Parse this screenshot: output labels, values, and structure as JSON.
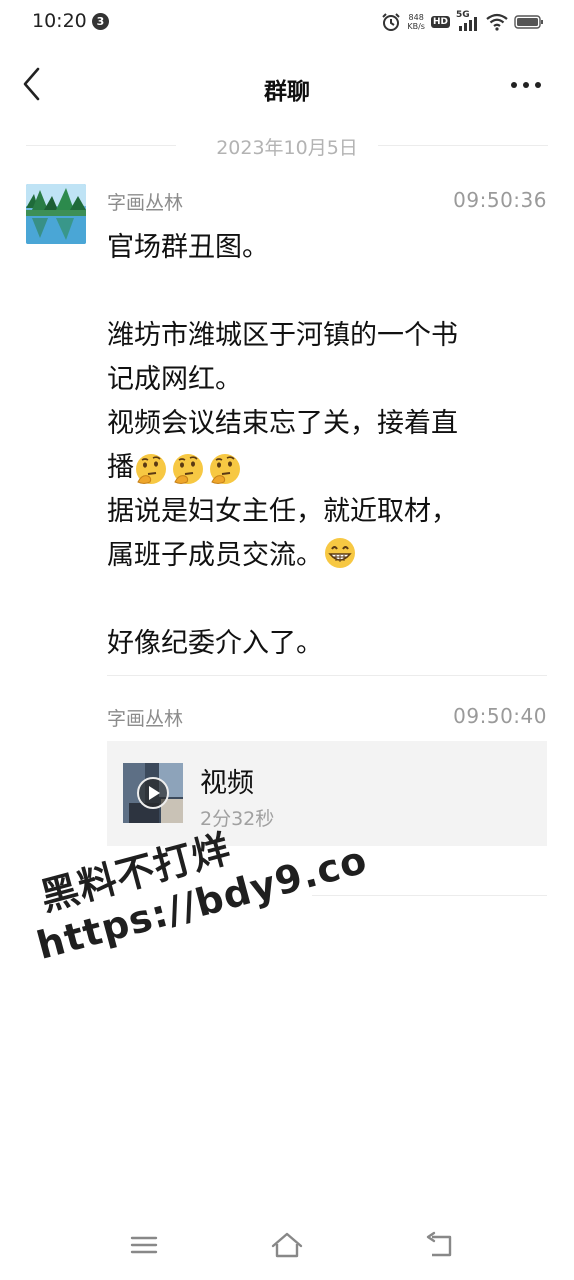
{
  "status_bar": {
    "time": "10:20",
    "notification_count": "3",
    "net_speed_value": "848",
    "net_speed_unit": "KB/s",
    "hd_label": "HD",
    "network_type": "5G",
    "icons": [
      "alarm-icon",
      "hd-icon",
      "signal-icon",
      "wifi-icon",
      "battery-icon"
    ]
  },
  "header": {
    "title": "群聊",
    "back_icon": "chevron-left-icon",
    "more_icon": "more-dots-icon"
  },
  "date_divider": "2023年10月5日",
  "messages": [
    {
      "sender": "字画丛林",
      "time": "09:50:36",
      "lines": [
        "官场群丑图。",
        "",
        "潍坊市潍城区于河镇的一个书",
        "记成网红。",
        "视频会议结束忘了关，接着直",
        "播",
        "据说是妇女主任，就近取材，",
        "属班子成员交流。",
        "",
        "好像纪委介入了。"
      ],
      "emojis": [
        "thinking-face-emoji",
        "grinning-face-emoji"
      ]
    },
    {
      "sender": "字画丛林",
      "time": "09:50:40",
      "video": {
        "title": "视频",
        "duration": "2分32秒",
        "icon": "play-icon"
      }
    }
  ],
  "watermark": {
    "line1": "黑料不打烊",
    "line2": "https://bdy9.co"
  },
  "nav_bar": {
    "icons": [
      "menu-icon",
      "home-icon",
      "back-icon"
    ]
  }
}
